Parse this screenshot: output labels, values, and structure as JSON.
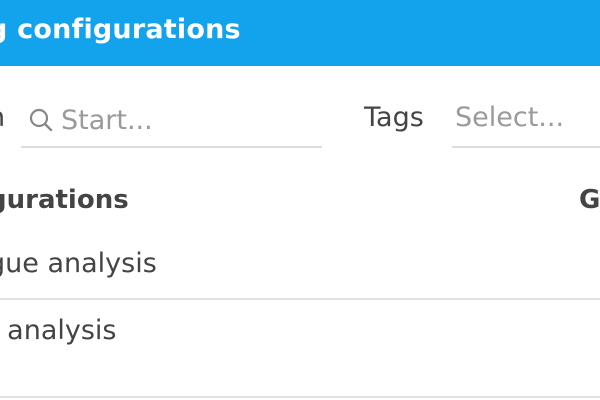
{
  "header": {
    "title": "g configurations"
  },
  "search": {
    "label": "h",
    "placeholder": "Start...",
    "icon": "search-icon"
  },
  "tags": {
    "label": "Tags",
    "placeholder": "Select..."
  },
  "table": {
    "columns": [
      "gurations",
      "G"
    ],
    "rows": [
      {
        "name": "gue analysis"
      },
      {
        "name": "t analysis"
      }
    ]
  },
  "colors": {
    "header_bg": "#12a3ec",
    "header_text": "#ffffff",
    "divider": "#e2e2e2"
  }
}
